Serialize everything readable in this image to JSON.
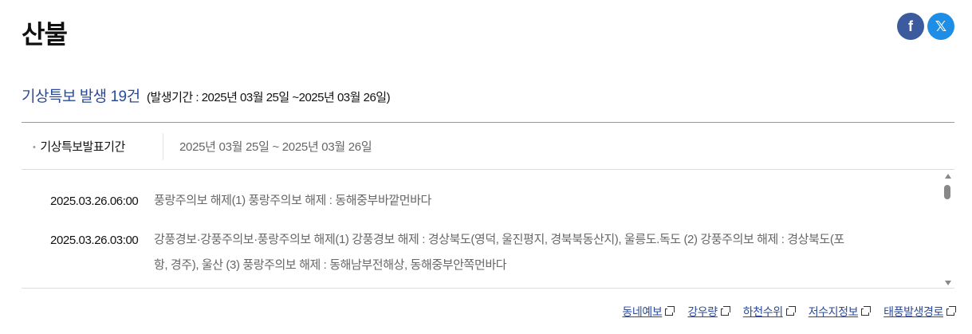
{
  "page": {
    "title": "산불"
  },
  "share": {
    "facebook_glyph": "f",
    "x_glyph": "𝕏",
    "facebook_color": "#3b5b9e",
    "x_color": "#1d8de6"
  },
  "summary": {
    "main": "기상특보 발생 19건",
    "period": "(발생기간 : 2025년 03월 25일 ~2025년 03월 26일)"
  },
  "info": {
    "label": "기상특보발표기간",
    "value": "2025년 03월 25일 ~ 2025년 03월 26일"
  },
  "entries": [
    {
      "time": "2025.03.26.06:00",
      "text": "풍랑주의보 해제(1) 풍랑주의보 해제 : 동해중부바깥먼바다"
    },
    {
      "time": "2025.03.26.03:00",
      "text": "강풍경보·강풍주의보·풍랑주의보 해제(1) 강풍경보 해제 : 경상북도(영덕, 울진평지, 경북북동산지), 울릉도.독도 (2) 강풍주의보 해제 : 경상북도(포항, 경주), 울산 (3) 풍랑주의보 해제 : 동해남부전해상, 동해중부안쪽먼바다"
    }
  ],
  "links": [
    "동네예보",
    "강우량",
    "하천수위",
    "저수지정보",
    "태풍발생경로"
  ]
}
